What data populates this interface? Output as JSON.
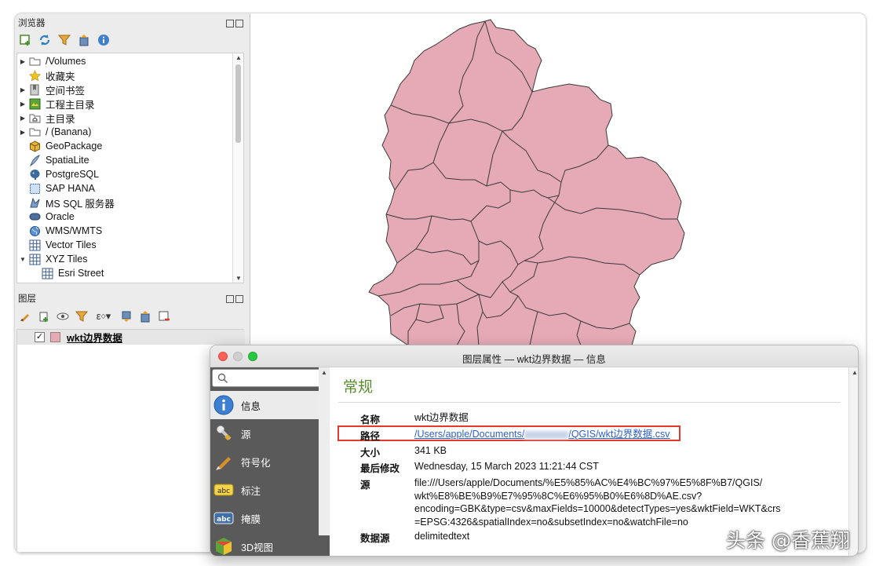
{
  "browser_panel": {
    "title": "浏览器",
    "tree": [
      {
        "label": "/Volumes",
        "icon": "folder-icon",
        "expander": "right"
      },
      {
        "label": "收藏夹",
        "icon": "star-icon",
        "expander": ""
      },
      {
        "label": "空间书签",
        "icon": "bookmark-icon",
        "expander": "right"
      },
      {
        "label": "工程主目录",
        "icon": "project-home-icon",
        "expander": "right"
      },
      {
        "label": "主目录",
        "icon": "home-folder-icon",
        "expander": "right"
      },
      {
        "label": "/ (Banana)",
        "icon": "folder-icon",
        "expander": "right"
      },
      {
        "label": "GeoPackage",
        "icon": "geopackage-icon",
        "expander": ""
      },
      {
        "label": "SpatiaLite",
        "icon": "spatialite-icon",
        "expander": ""
      },
      {
        "label": "PostgreSQL",
        "icon": "postgresql-icon",
        "expander": ""
      },
      {
        "label": "SAP HANA",
        "icon": "sap-hana-icon",
        "expander": ""
      },
      {
        "label": "MS SQL 服务器",
        "icon": "mssql-icon",
        "expander": ""
      },
      {
        "label": "Oracle",
        "icon": "oracle-icon",
        "expander": ""
      },
      {
        "label": "WMS/WMTS",
        "icon": "globe-icon",
        "expander": ""
      },
      {
        "label": "Vector Tiles",
        "icon": "grid-icon",
        "expander": ""
      },
      {
        "label": "XYZ Tiles",
        "icon": "grid-icon",
        "expander": "down"
      },
      {
        "label": "Esri Street",
        "icon": "grid-icon",
        "expander": "",
        "indent": true
      }
    ]
  },
  "layers_panel": {
    "title": "图层",
    "layers": [
      {
        "name": "wkt边界数据",
        "checked": true,
        "color": "#e6aab6"
      }
    ]
  },
  "dialog": {
    "title": "图层属性 — wkt边界数据 — 信息",
    "search_placeholder": "",
    "nav": [
      {
        "label": "信息",
        "icon": "info-icon",
        "selected": true
      },
      {
        "label": "源",
        "icon": "source-wrench-icon",
        "selected": false
      },
      {
        "label": "符号化",
        "icon": "paintbrush-icon",
        "selected": false
      },
      {
        "label": "标注",
        "icon": "abc-label-icon",
        "selected": false
      },
      {
        "label": "掩膜",
        "icon": "abc-mask-icon",
        "selected": false
      },
      {
        "label": "3D视图",
        "icon": "cube-icon",
        "selected": false
      }
    ],
    "section_title": "常规",
    "fields": {
      "name_label": "名称",
      "name_value": "wkt边界数据",
      "path_label": "路径",
      "path_start": "/Users/apple/Documents/",
      "path_end": "/QGIS/wkt边界数据.csv",
      "size_label": "大小",
      "size_value": "341 KB",
      "modified_label": "最后修改",
      "modified_value": "Wednesday, 15 March 2023 11:21:44 CST",
      "source_label": "源",
      "source_lines": [
        "file:///Users/apple/Documents/%E5%85%AC%E4%BC%97%E5%8F%B7/QGIS/",
        "wkt%E8%BE%B9%E7%95%8C%E6%95%B0%E6%8D%AE.csv?",
        "encoding=GBK&type=csv&maxFields=10000&detectTypes=yes&wktField=WKT&crs",
        "=EPSG:4326&spatialIndex=no&subsetIndex=no&watchFile=no"
      ],
      "provider_label": "数据源",
      "provider_value": "delimitedtext"
    }
  },
  "map": {
    "fill_color": "#e6aab6",
    "stroke_color": "#3a3a3a"
  },
  "watermark": "头条 @香蕉翔"
}
